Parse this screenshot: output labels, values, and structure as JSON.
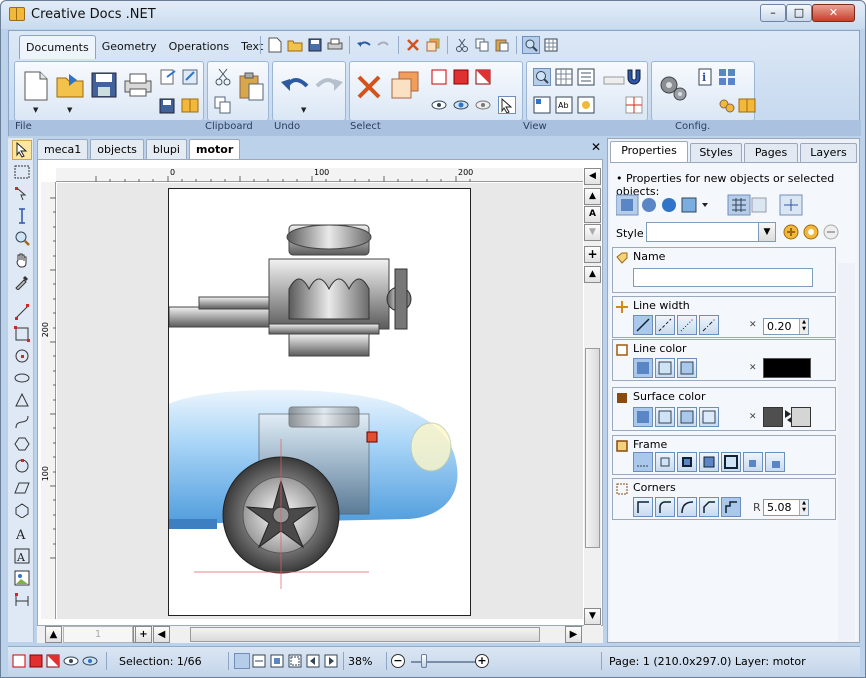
{
  "window": {
    "title": "Creative Docs .NET",
    "minimize": "–",
    "maximize": "□",
    "close": "✕"
  },
  "ribbon": {
    "tabs": [
      "Documents",
      "Geometry",
      "Operations",
      "Text"
    ],
    "active_tab": "Documents",
    "groups": [
      "File",
      "Clipboard",
      "Undo",
      "Select",
      "View",
      "Config."
    ]
  },
  "documents": {
    "tabs": [
      "meca1",
      "objects",
      "blupi",
      "motor"
    ],
    "active": "motor",
    "close": "✕"
  },
  "rulers": {
    "h_ticks": [
      "0",
      "100",
      "200"
    ],
    "v_ticks": [
      "200",
      "100"
    ]
  },
  "scroll": {
    "page_field": "1"
  },
  "panel": {
    "tabs": [
      "Properties",
      "Styles",
      "Pages",
      "Layers"
    ],
    "active_tab": "Properties",
    "info": "• Properties for new objects or selected objects:",
    "style_label": "Style",
    "style_value": "",
    "sections": {
      "name": {
        "title": "Name",
        "value": ""
      },
      "line_width": {
        "title": "Line width",
        "value": "0.20"
      },
      "line_color": {
        "title": "Line color",
        "color": "#000000"
      },
      "surface_color": {
        "title": "Surface color",
        "color": "#4f4f4f"
      },
      "frame": {
        "title": "Frame"
      },
      "corners": {
        "title": "Corners",
        "r_label": "R",
        "value": "5.08"
      }
    }
  },
  "status": {
    "selection": "Selection: 1/66",
    "zoom": "38%",
    "page_info": "Page: 1 (210.0x297.0)  Layer: motor"
  },
  "colors": {
    "accent": "#bcd1ea",
    "ribbon": "#c3d7ee",
    "car_body": "#8fc4f0"
  }
}
